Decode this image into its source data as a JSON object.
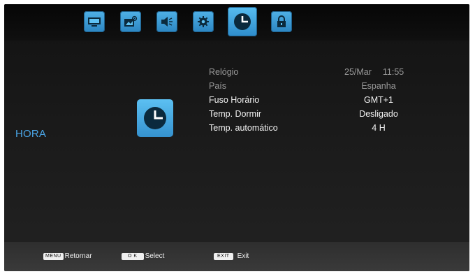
{
  "menu_tabs": [
    {
      "name": "picture-tv-icon"
    },
    {
      "name": "image-settings-icon"
    },
    {
      "name": "sound-icon"
    },
    {
      "name": "settings-gear-icon"
    },
    {
      "name": "clock-icon"
    },
    {
      "name": "lock-icon"
    }
  ],
  "section": {
    "title": "HORA"
  },
  "settings": [
    {
      "label": "Relógio",
      "date": "25/Mar",
      "time": "11:55"
    },
    {
      "label": "País",
      "value": "Espanha"
    },
    {
      "label": "Fuso Horário",
      "value": "GMT+1"
    },
    {
      "label": "Temp. Dormir",
      "value": "Desligado"
    },
    {
      "label": "Temp. automático",
      "value": "4 H"
    }
  ],
  "footer": {
    "menu_key": "MENU",
    "menu_label": "Retornar",
    "ok_key": "O K",
    "ok_label": "Select",
    "exit_key": "EXIT",
    "exit_label": "Exit"
  },
  "colors": {
    "accent": "#4aa6e8",
    "tab_blue": "#3a9ad6",
    "title_blue": "#4aa6e8"
  }
}
